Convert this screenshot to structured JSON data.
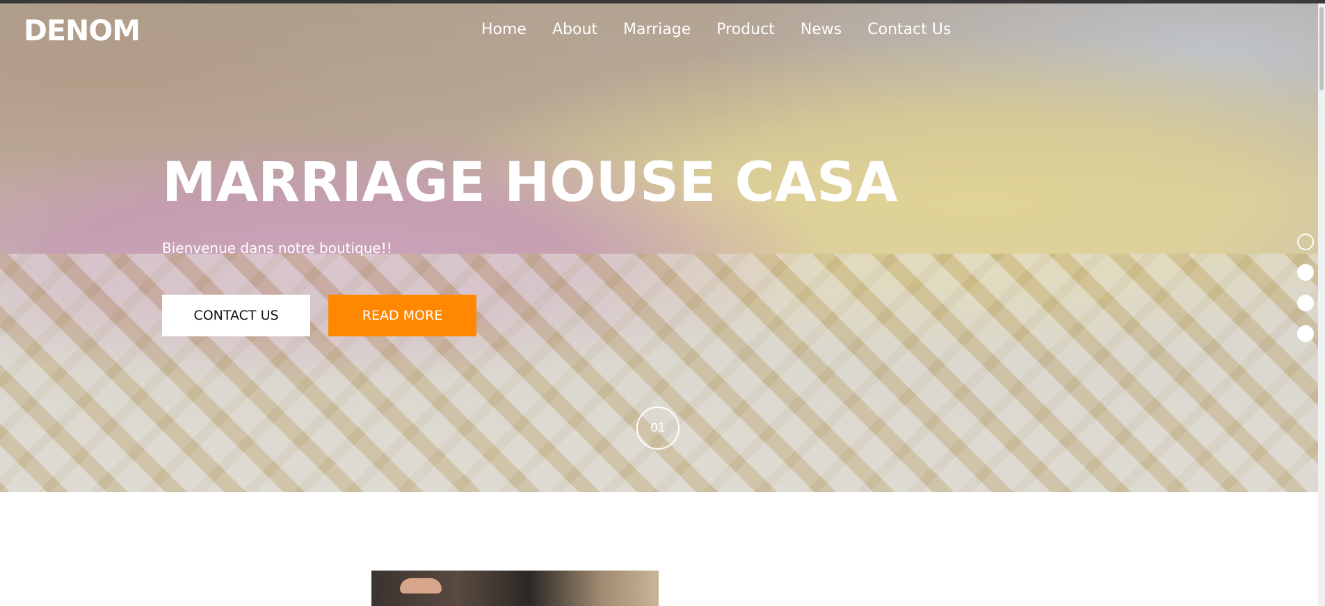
{
  "header": {
    "logo": "DENOM",
    "nav": [
      "Home",
      "About",
      "Marriage",
      "Product",
      "News",
      "Contact Us"
    ]
  },
  "hero": {
    "title": "MARRIAGE HOUSE CASA",
    "subtitle": "Bienvenue dans notre boutique!!",
    "buttons": {
      "contact": "CONTACT US",
      "read_more": "READ MORE"
    },
    "slide_number": "01",
    "slider_dots": 4,
    "active_dot": 0,
    "accent_color": "#ff8800"
  },
  "icons": [
    "slider-dot-icon"
  ]
}
